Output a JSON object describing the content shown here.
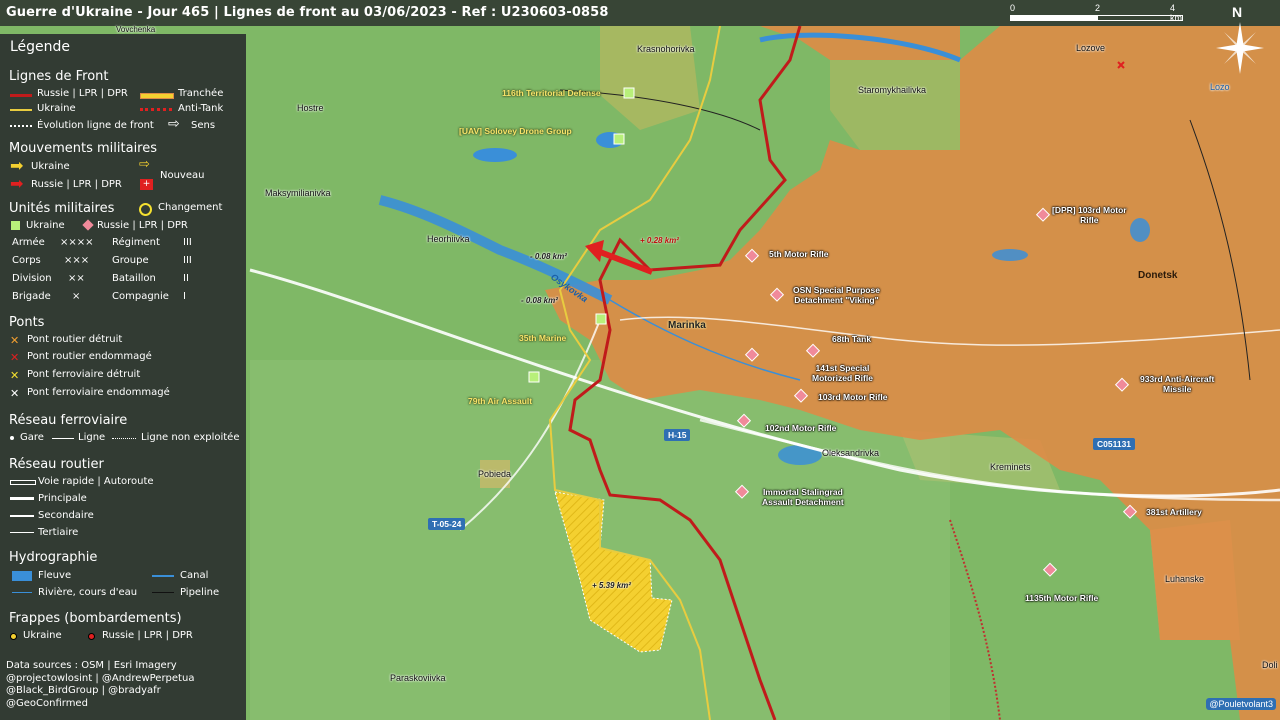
{
  "title": "Guerre d'Ukraine - Jour 465 | Lignes de front au 03/06/2023 - Ref : U230603-0858",
  "scale": {
    "l0": "0",
    "l1": "2",
    "l2": "4 km"
  },
  "north": "N",
  "colors": {
    "russia_zone": "#e08a45",
    "ukraine_gain": "#f4d030",
    "frontline_ru": "#c01b1b",
    "frontline_ua": "#e8cc40",
    "ukraine_unit": "#b8f07a",
    "russia_unit": "#f08a9a"
  },
  "legend": {
    "title": "Légende",
    "front": {
      "heading": "Lignes de Front",
      "russia": "Russie | LPR | DPR",
      "trench": "Tranchée",
      "ukraine": "Ukraine",
      "antitank": "Anti-Tank",
      "evolution": "Évolution ligne de front",
      "direction": "Sens"
    },
    "moves": {
      "heading": "Mouvements militaires",
      "ukraine": "Ukraine",
      "russia": "Russie | LPR | DPR",
      "new": "Nouveau"
    },
    "units": {
      "heading": "Unités militaires",
      "change": "Changement",
      "ukraine": "Ukraine",
      "russia": "Russie | LPR | DPR",
      "rows": [
        {
          "a": "Armée",
          "as": "××××",
          "b": "Régiment",
          "bs": "III"
        },
        {
          "a": "Corps",
          "as": "×××",
          "b": "Groupe",
          "bs": "III"
        },
        {
          "a": "Division",
          "as": "××",
          "b": "Bataillon",
          "bs": "II"
        },
        {
          "a": "Brigade",
          "as": "×",
          "b": "Compagnie",
          "bs": "I"
        }
      ]
    },
    "bridges": {
      "heading": "Ponts",
      "road_destroyed": "Pont routier détruit",
      "road_damaged": "Pont routier endommagé",
      "rail_destroyed": "Pont ferroviaire détruit",
      "rail_damaged": "Pont ferroviaire endommagé"
    },
    "rail": {
      "heading": "Réseau ferroviaire",
      "station": "Gare",
      "line": "Ligne",
      "unused": "Ligne non exploitée"
    },
    "roads": {
      "heading": "Réseau routier",
      "fast": "Voie rapide | Autoroute",
      "main": "Principale",
      "secondary": "Secondaire",
      "tertiary": "Tertiaire"
    },
    "hydro": {
      "heading": "Hydrographie",
      "river": "Fleuve",
      "canal": "Canal",
      "stream": "Rivière, cours d'eau",
      "pipeline": "Pipeline"
    },
    "strikes": {
      "heading": "Frappes (bombardements)",
      "ukraine": "Ukraine",
      "russia": "Russie | LPR | DPR"
    },
    "sources": [
      "Data sources : OSM | Esri Imagery",
      "@projectowlosint | @AndrewPerpetua",
      "@Black_BirdGroup | @bradyafr",
      "@GeoConfirmed"
    ]
  },
  "places": {
    "vovchenka": "Vovchenka",
    "krasnohorivka": "Krasnohorivka",
    "lozove": "Lozove",
    "lozo": "Lozo",
    "hostre": "Hostre",
    "staromykhailivka": "Staromykhailivka",
    "maksymilianivka": "Maksymilianivka",
    "heorhiivka": "Heorhiivka",
    "marinka": "Marinka",
    "donetsk": "Donetsk",
    "pobieda": "Pobieda",
    "oleksandrivka": "Oleksandrivka",
    "kreminets": "Kreminets",
    "luhanske": "Luhanske",
    "paraskoviivka": "Paraskoviivka",
    "doli": "Doli",
    "osykovka": "Osykovka"
  },
  "roads": {
    "h15": "H-15",
    "c051131": "C051131",
    "t0524": "T-05-24"
  },
  "changes": {
    "c1": "+ 0.28 km²",
    "c2": "- 0.08 km²",
    "c3": "- 0.08 km²",
    "c4": "+ 5.39 km²"
  },
  "ua_units": {
    "u116": "116th Territorial Defense",
    "uav": "[UAV] Solovey Drone Group",
    "u35": "35th Marine",
    "u79": "79th Air Assault"
  },
  "ru_units": {
    "r103dpr": "[DPR] 103rd Motor\nRifle",
    "r5": "5th Motor Rifle",
    "osn": "OSN Special Purpose\nDetachment \"Viking\"",
    "r68": "68th Tank",
    "r141": "141st Special\nMotorized Rifle",
    "r103": "103rd Motor Rifle",
    "r933": "933rd Anti-Aircraft\nMissile",
    "r102": "102nd Motor Rifle",
    "stal": "Immortal Stalingrad\nAssault Detachment",
    "r381": "381st Artillery",
    "r1135": "1135th Motor Rifle"
  },
  "credit": "@Pouletvolant3"
}
